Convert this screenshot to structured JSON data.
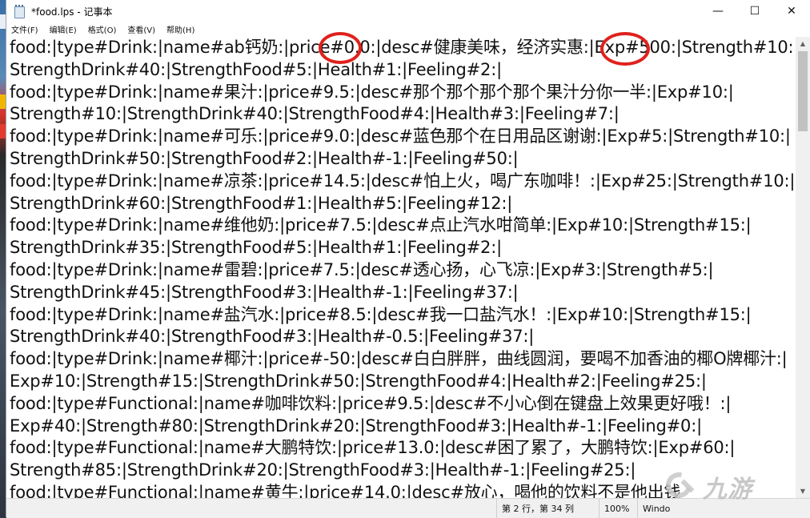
{
  "window": {
    "title": "*food.lps - 记事本",
    "controls": {
      "minimize": "—",
      "maximize": "☐",
      "close": "✕"
    }
  },
  "menu": [
    {
      "label": "文件(F)"
    },
    {
      "label": "编辑(E)"
    },
    {
      "label": "格式(O)"
    },
    {
      "label": "查看(V)"
    },
    {
      "label": "帮助(H)"
    }
  ],
  "lines": [
    "food:|type#Drink:|name#ab钙奶:|price#0.0:|desc#健康美味，经济实惠:|Exp#500:|Strength#10:|",
    "StrengthDrink#40:|StrengthFood#5:|Health#1:|Feeling#2:|",
    "food:|type#Drink:|name#果汁:|price#9.5:|desc#那个那个那个那个果汁分你一半:|Exp#10:|",
    "Strength#10:|StrengthDrink#40:|StrengthFood#4:|Health#3:|Feeling#7:|",
    "food:|type#Drink:|name#可乐:|price#9.0:|desc#蓝色那个在日用品区谢谢:|Exp#5:|Strength#10:|",
    "StrengthDrink#50:|StrengthFood#2:|Health#-1:|Feeling#50:|",
    "food:|type#Drink:|name#凉茶:|price#14.5:|desc#怕上火，喝广东咖啡！:|Exp#25:|Strength#10:|",
    "StrengthDrink#60:|StrengthFood#1:|Health#5:|Feeling#12:|",
    "food:|type#Drink:|name#维他奶:|price#7.5:|desc#点止汽水咁简单:|Exp#10:|Strength#15:|",
    "StrengthDrink#35:|StrengthFood#5:|Health#1:|Feeling#2:|",
    "food:|type#Drink:|name#雷碧:|price#7.5:|desc#透心扬，心飞凉:|Exp#3:|Strength#5:|",
    "StrengthDrink#45:|StrengthFood#3:|Health#-1:|Feeling#37:|",
    "food:|type#Drink:|name#盐汽水:|price#8.5:|desc#我一口盐汽水！:|Exp#10:|Strength#15:|",
    "StrengthDrink#40:|StrengthFood#3:|Health#-0.5:|Feeling#37:|",
    "food:|type#Drink:|name#椰汁:|price#-50:|desc#白白胖胖，曲线圆润，要喝不加香油的椰O牌椰汁:|",
    "Exp#10:|Strength#15:|StrengthDrink#50:|StrengthFood#4:|Health#2:|Feeling#25:|",
    "food:|type#Functional:|name#咖啡饮料:|price#9.5:|desc#不小心倒在键盘上效果更好哦！:|",
    "Exp#40:|Strength#80:|StrengthDrink#20:|StrengthFood#3:|Health#-1:|Feeling#0:|",
    "food:|type#Functional:|name#大鹏特饮:|price#13.0:|desc#困了累了，大鹏特饮:|Exp#60:|",
    "Strength#85:|StrengthDrink#20:|StrengthFood#3:|Health#-1:|Feeling#25:|",
    "food:|type#Functional:|name#黄牛:|price#14.0:|desc#放心，喝他的饮料不是他出钱"
  ],
  "status": {
    "position": "第 2 行，第 34 列",
    "zoom": "100%",
    "line_ending": "Windo"
  },
  "watermark": {
    "text": "九游"
  },
  "colors": {
    "annotation": "#e0211c"
  }
}
